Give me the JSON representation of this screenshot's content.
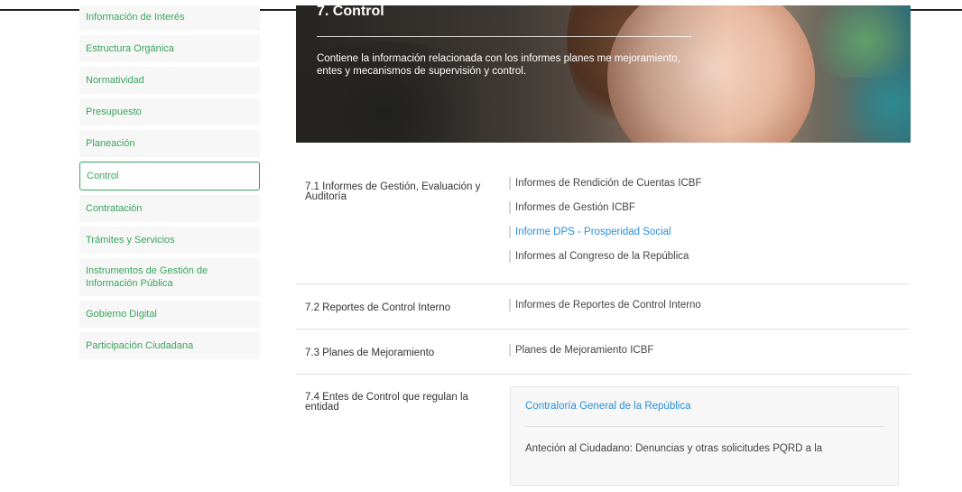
{
  "sidebar": {
    "items": [
      {
        "label": "Información de Interés"
      },
      {
        "label": "Estructura Orgánica"
      },
      {
        "label": "Normatividad"
      },
      {
        "label": "Presupuesto"
      },
      {
        "label": "Planeación"
      },
      {
        "label": "Control",
        "active": true
      },
      {
        "label": "Contratación"
      },
      {
        "label": "Trámites y Servicios"
      },
      {
        "label": "Instrumentos de Gestión de Información Pública"
      },
      {
        "label": "Gobierno Digital"
      },
      {
        "label": "Participación Ciudadana"
      }
    ]
  },
  "hero": {
    "title": "7. Control",
    "text": "Contiene la información relacionada con los informes planes me mejoramiento, entes y mecanismos de supervisión y control."
  },
  "rows": [
    {
      "label": "7.1 Informes de Gestión, Evaluación y Auditoría",
      "links": [
        "Informes de Rendición de Cuentas ICBF",
        "Informes de Gestión ICBF",
        "Informe DPS - Prosperidad Social",
        "Informes al Congreso de la República"
      ]
    },
    {
      "label": "7.2 Reportes de Control Interno",
      "links": [
        "Informes de Reportes de Control Interno"
      ]
    },
    {
      "label": "7.3 Planes de Mejoramiento",
      "links": [
        "Planes de Mejoramiento ICBF"
      ]
    },
    {
      "label": "7.4 Entes de Control que regulan la entidad",
      "panel_link": "Contraloría General de la República",
      "panel_text": "Anteción al Ciudadano: Denuncias y otras solicitudes PQRD a la"
    }
  ],
  "colors": {
    "accent_green": "#3aa35f",
    "link_blue": "#2a8fd6"
  }
}
